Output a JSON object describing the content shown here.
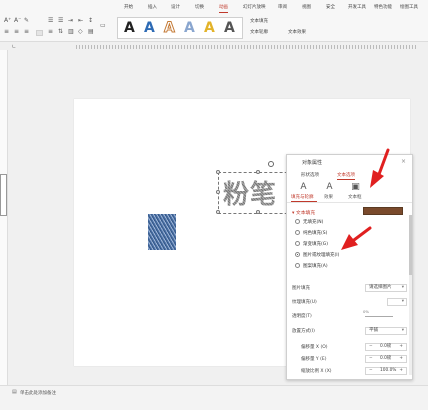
{
  "menu": {
    "tabs": [
      "开始",
      "插入",
      "设计",
      "切换",
      "动画",
      "幻灯片放映",
      "审阅",
      "视图",
      "安全",
      "开发工具",
      "特色功能",
      "绘图工具"
    ],
    "active_index": 4
  },
  "ribbon": {
    "wordart_glyph": "A",
    "text_fill_label": "文本填充",
    "text_outline_label": "文本轮廓",
    "text_effect_label": "文本效果"
  },
  "slide": {
    "big_text": "粉笔"
  },
  "panel": {
    "title": "对象属性",
    "close": "×",
    "tabs": [
      "形状选项",
      "文本选项"
    ],
    "active_tab": 1,
    "sub_tabs": [
      "填充与轮廓",
      "效果",
      "文本框"
    ],
    "section_title": "▾ 文本填充",
    "fill_options": [
      {
        "label": "无填充(N)",
        "checked": false
      },
      {
        "label": "纯色填充(S)",
        "checked": false
      },
      {
        "label": "渐变填充(G)",
        "checked": false
      },
      {
        "label": "图片或纹理填充(I)",
        "checked": true
      },
      {
        "label": "图案填充(A)",
        "checked": false
      }
    ],
    "picture_fill_label": "图片填充",
    "picture_fill_value": "请选择图片",
    "texture_label": "纹理填充(U)",
    "transparency_label": "透明度(T)",
    "transparency_value": "0%",
    "placement_label": "放置方式(I)",
    "placement_value": "平铺",
    "offset_x_label": "偏移量 X (O)",
    "offset_x_value": "0.0磅",
    "offset_y_label": "偏移量 Y (E)",
    "offset_y_value": "0.0磅",
    "scale_x_label": "缩放比例 X (X)",
    "scale_x_value": "100.0%"
  },
  "status": {
    "notes_hint": "单击此处添加备注"
  },
  "colors": {
    "accent": "#c0392b",
    "swatch": "#7a4a2c",
    "arrow": "#e02020"
  }
}
